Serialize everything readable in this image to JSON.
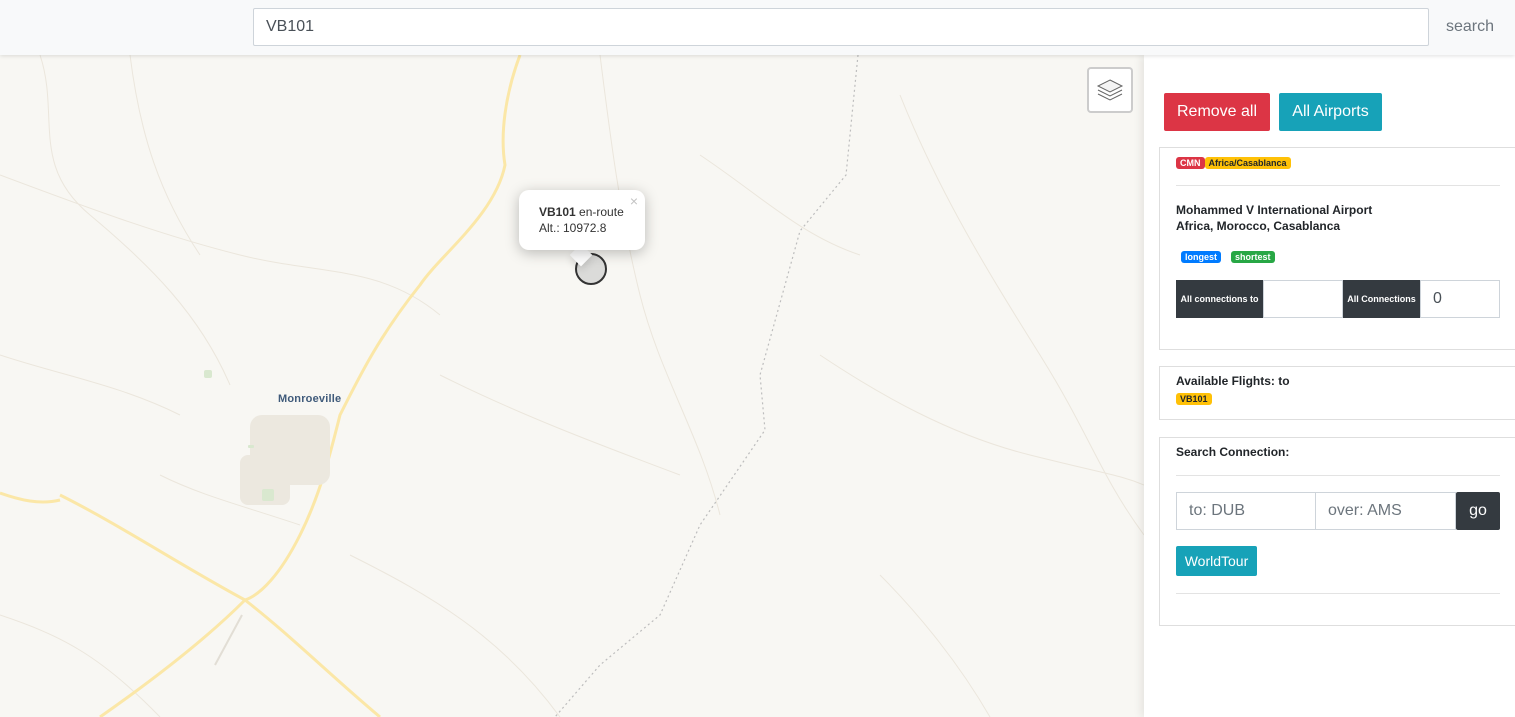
{
  "header": {
    "search_value": "VB101",
    "search_button": "search"
  },
  "map": {
    "city_label": "Monroeville",
    "popup": {
      "flight": "VB101",
      "status": "en-route",
      "altitude": "Alt.: 10972.8",
      "close": "×"
    }
  },
  "sidebar": {
    "remove_all": "Remove all",
    "all_airports": "All Airports",
    "airport": {
      "code": "CMN",
      "timezone": "Africa/Casablanca",
      "name": "Mohammed V International Airport",
      "location": "Africa, Morocco, Casablanca",
      "longest": "longest",
      "shortest": "shortest",
      "all_connections_to": "All connections to",
      "all_connections_to_value": "",
      "all_connections": "All Connections",
      "all_connections_value": "0"
    },
    "flights": {
      "title": "Available Flights: to",
      "items": [
        "VB101"
      ]
    },
    "search_connection": {
      "title": "Search Connection:",
      "to_placeholder": "to: DUB",
      "over_placeholder": "over: AMS",
      "go": "go",
      "worldtour": "WorldTour"
    }
  },
  "colors": {
    "danger": "#dc3545",
    "info": "#17a2b8",
    "warning": "#ffc107",
    "primary": "#007bff",
    "success": "#28a745",
    "dark": "#343a40",
    "map_background": "#f8f7f3",
    "road_major": "#fbe7a7"
  }
}
